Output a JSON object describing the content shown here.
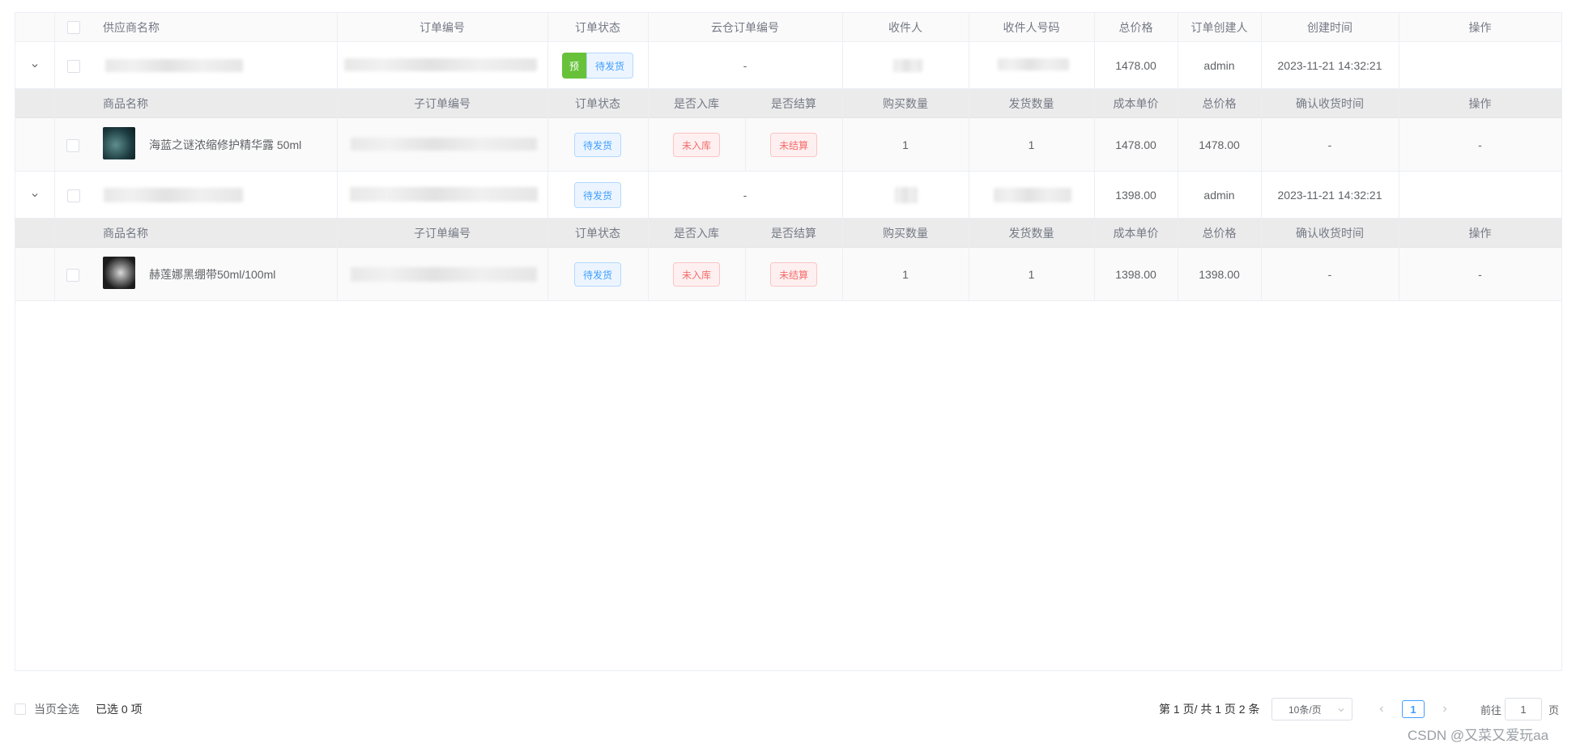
{
  "table": {
    "headers": [
      "供应商名称",
      "订单编号",
      "订单状态",
      "云仓订单编号",
      "收件人",
      "收件人号码",
      "总价格",
      "订单创建人",
      "创建时间",
      "操作"
    ],
    "sub_headers": [
      "商品名称",
      "子订单编号",
      "订单状态",
      "是否入库",
      "是否结算",
      "购买数量",
      "发货数量",
      "成本单价",
      "总价格",
      "确认收货时间",
      "操作"
    ],
    "orders": [
      {
        "presale_tag": "预",
        "status": "待发货",
        "cloud_order_no": "-",
        "total": "1478.00",
        "creator": "admin",
        "created_at": "2023-11-21 14:32:21",
        "item": {
          "name": "海蓝之谜浓缩修护精华露 50ml",
          "status": "待发货",
          "stocked": "未入库",
          "settled": "未结算",
          "qty": "1",
          "shipped": "1",
          "unit_cost": "1478.00",
          "total": "1478.00",
          "confirm_time": "-",
          "action": "-"
        }
      },
      {
        "status": "待发货",
        "cloud_order_no": "-",
        "total": "1398.00",
        "creator": "admin",
        "created_at": "2023-11-21 14:32:21",
        "item": {
          "name": "赫莲娜黑绷带50ml/100ml",
          "status": "待发货",
          "stocked": "未入库",
          "settled": "未结算",
          "qty": "1",
          "shipped": "1",
          "unit_cost": "1398.00",
          "total": "1398.00",
          "confirm_time": "-",
          "action": "-"
        }
      }
    ]
  },
  "footer": {
    "select_all_label": "当页全选",
    "selected_count": "已选 0 项",
    "page_info": "第 1 页/ 共 1 页 2 条",
    "page_size": "10条/页",
    "current_page": "1",
    "goto_prefix": "前往",
    "goto_value": "1",
    "goto_suffix": "页"
  },
  "watermark": "CSDN @又菜又爱玩aa",
  "colors": {
    "primary": "#409eff",
    "danger": "#f56c6c",
    "success": "#67c23a",
    "border": "#ebeef5"
  }
}
